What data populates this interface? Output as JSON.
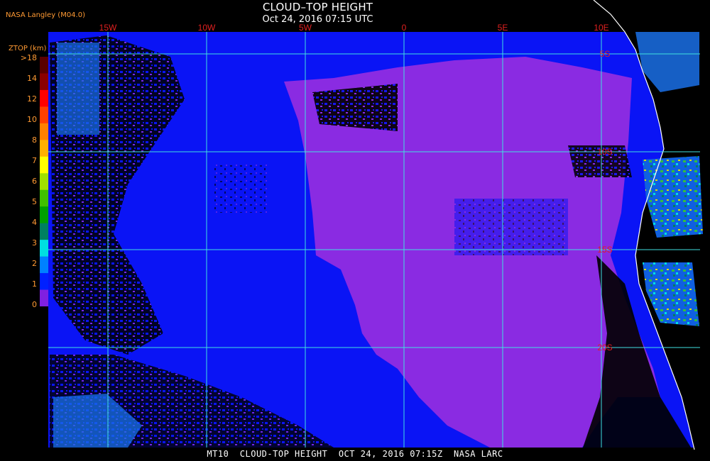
{
  "header": {
    "title": "CLOUD–TOP HEIGHT",
    "subtitle": "Oct 24, 2016 07:15 UTC",
    "source": "NASA Langley (M04.0)"
  },
  "legend": {
    "title": "ZTOP (km)",
    "labels": [
      ">18",
      "14",
      "12",
      "10",
      "8",
      "7",
      "6",
      "5",
      "4",
      "3",
      "2",
      "1",
      "0"
    ],
    "colors": [
      "#5a0000",
      "#8b0000",
      "#ff0000",
      "#ff4000",
      "#ff8000",
      "#ffb000",
      "#ffff00",
      "#a0e000",
      "#40c000",
      "#00a000",
      "#008060",
      "#00e0e0",
      "#0080ff",
      "#0020ff",
      "#8020e0"
    ]
  },
  "map": {
    "longitude_labels": [
      "15W",
      "10W",
      "5W",
      "0",
      "5E",
      "10E"
    ],
    "latitude_labels": [
      "5S",
      "10S",
      "15S",
      "20S"
    ],
    "grid_color": "#40e0e0",
    "label_color": "#e02020",
    "ocean_low_cloud_color": "#8a2be2",
    "clear_ocean_color": "#0a14f5",
    "land_color": "#000000",
    "coastline_color": "#ffffff"
  },
  "footer": {
    "text": "MT10  CLOUD-TOP HEIGHT  OCT 24, 2016 07:15Z  NASA LARC"
  }
}
